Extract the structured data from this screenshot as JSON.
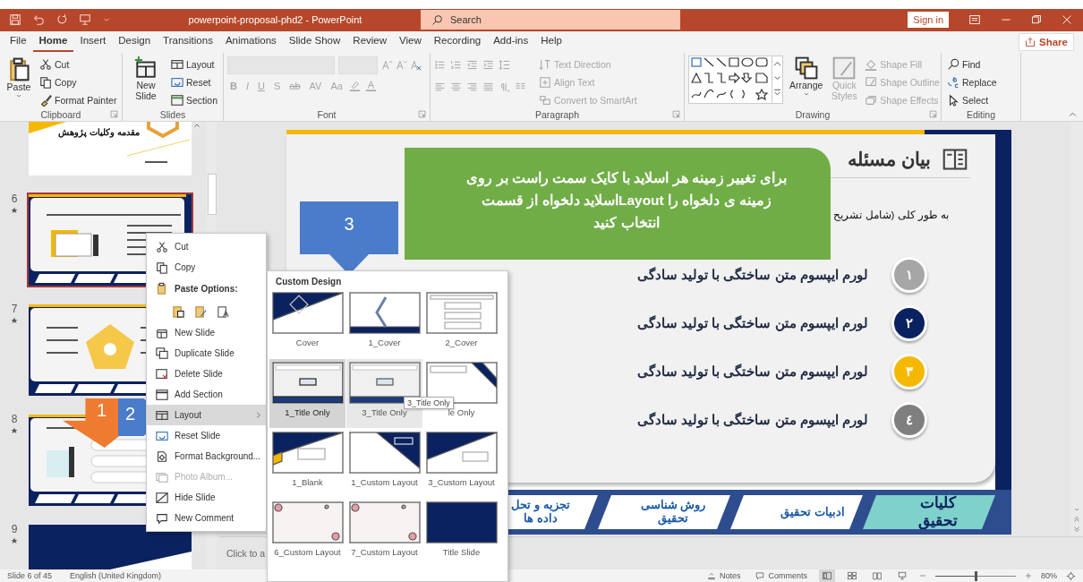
{
  "window": {
    "title": "powerpoint-proposal-phd2  -  PowerPoint",
    "search_placeholder": "Search",
    "sign_in": "Sign in"
  },
  "menu_tabs": [
    {
      "label": "File",
      "selected": false
    },
    {
      "label": "Home",
      "selected": true
    },
    {
      "label": "Insert",
      "selected": false
    },
    {
      "label": "Design",
      "selected": false
    },
    {
      "label": "Transitions",
      "selected": false
    },
    {
      "label": "Animations",
      "selected": false
    },
    {
      "label": "Slide Show",
      "selected": false
    },
    {
      "label": "Review",
      "selected": false
    },
    {
      "label": "View",
      "selected": false
    },
    {
      "label": "Recording",
      "selected": false
    },
    {
      "label": "Add-ins",
      "selected": false
    },
    {
      "label": "Help",
      "selected": false
    }
  ],
  "share": "Share",
  "ribbon": {
    "clipboard": {
      "label": "Clipboard",
      "paste": "Paste",
      "cut": "Cut",
      "copy": "Copy",
      "format_painter": "Format Painter"
    },
    "slides": {
      "label": "Slides",
      "new_slide": "New Slide",
      "layout": "Layout",
      "reset": "Reset",
      "section": "Section"
    },
    "font": {
      "label": "Font",
      "disabled": true,
      "buttons": [
        "B",
        "I",
        "U",
        "S",
        "ab",
        "AV",
        "Aa"
      ]
    },
    "paragraph": {
      "label": "Paragraph",
      "disabled": true,
      "text_direction": "Text Direction",
      "align_text": "Align Text",
      "convert": "Convert to SmartArt"
    },
    "drawing": {
      "label": "Drawing",
      "arrange": "Arrange",
      "quick_styles": "Quick Styles",
      "quick_styles_disabled": true,
      "shape_fill": "Shape Fill",
      "shape_outline": "Shape Outline",
      "shape_effects": "Shape Effects",
      "shape_format_disabled": true
    },
    "editing": {
      "label": "Editing",
      "find": "Find",
      "replace": "Replace",
      "select": "Select"
    }
  },
  "thumbnails": [
    {
      "kind": "intro",
      "title": "مقدمه وکلیات پژوهش",
      "selected": false
    },
    {
      "kind": "problem",
      "number": "6",
      "selected": true
    },
    {
      "kind": "pentagon",
      "number": "7",
      "selected": false
    },
    {
      "kind": "list",
      "number": "8",
      "selected": false
    },
    {
      "kind": "section",
      "number": "9",
      "selected": false
    }
  ],
  "slide": {
    "heading": "بیان مسئله",
    "intro": "به طور کلی (شامل تشریح",
    "points": [
      {
        "number": "١",
        "text": "لورم ایپسوم متن ساختگی با تولید سادگی",
        "color": "#a6a6a6"
      },
      {
        "number": "٢",
        "text": "لورم ایپسوم متن ساختگی با تولید سادگی",
        "color": "#0b2260"
      },
      {
        "number": "٣",
        "text": "لورم ایپسوم متن ساختگی با تولید سادگی",
        "color": "#f5b800"
      },
      {
        "number": "٤",
        "text": "لورم ایپسوم متن ساختگی با تولید سادگی",
        "color": "#7f7f7f"
      }
    ],
    "footer_tabs": [
      {
        "label": "کلیات تحقیق",
        "selected": true
      },
      {
        "label": "ادبیات تحقیق",
        "selected": false
      },
      {
        "label": "روش شناسی تحقیق",
        "selected": false
      },
      {
        "label": "تجزیه و تحل داده ها",
        "selected": false
      }
    ]
  },
  "callout": {
    "text": "برای تغییر زمینه هر اسلاید با کایک سمت راست بر روی\nزمینه ی دلخواه را  Layoutاسلاید دلخواه از قسمت\nانتخاب کنید"
  },
  "step_arrows": [
    {
      "label": "1",
      "kind": "down-orange"
    },
    {
      "label": "2",
      "kind": "right-blue"
    },
    {
      "label": "3",
      "kind": "down-blue"
    }
  ],
  "context_menu": [
    {
      "kind": "command",
      "label": "Cut",
      "disabled": false,
      "highlighted": false
    },
    {
      "kind": "command",
      "label": "Copy",
      "disabled": false,
      "highlighted": false
    },
    {
      "kind": "header",
      "label": "Paste Options:",
      "disabled": false,
      "highlighted": false
    },
    {
      "kind": "paste",
      "disabled": false,
      "highlighted": false
    },
    {
      "kind": "command",
      "label": "New Slide",
      "disabled": false,
      "highlighted": false
    },
    {
      "kind": "command",
      "label": "Duplicate Slide",
      "disabled": false,
      "highlighted": false
    },
    {
      "kind": "command",
      "label": "Delete Slide",
      "disabled": false,
      "highlighted": false
    },
    {
      "kind": "command",
      "label": "Add Section",
      "disabled": false,
      "highlighted": false
    },
    {
      "kind": "submenu",
      "label": "Layout",
      "disabled": false,
      "highlighted": true
    },
    {
      "kind": "command",
      "label": "Reset Slide",
      "disabled": false,
      "highlighted": false
    },
    {
      "kind": "command",
      "label": "Format Background...",
      "disabled": false,
      "highlighted": false
    },
    {
      "kind": "command",
      "label": "Photo Album...",
      "disabled": true,
      "highlighted": false
    },
    {
      "kind": "command",
      "label": "Hide Slide",
      "disabled": false,
      "highlighted": false
    },
    {
      "kind": "command",
      "label": "New Comment",
      "disabled": false,
      "highlighted": false
    }
  ],
  "layout_gallery": {
    "title": "Custom Design",
    "tooltip": "3_Title Only",
    "items": [
      {
        "kind": "diagonal",
        "label": "Cover",
        "selected": false,
        "hovered": false
      },
      {
        "kind": "chevron",
        "label": "1_Cover",
        "selected": false,
        "hovered": false
      },
      {
        "kind": "boxes",
        "label": "2_Cover",
        "selected": false,
        "hovered": false
      },
      {
        "kind": "title-only",
        "label": "1_Title Only",
        "selected": true,
        "hovered": false
      },
      {
        "kind": "title-only",
        "label": "3_Title Only",
        "selected": false,
        "hovered": true
      },
      {
        "kind": "corner",
        "label": "le Only",
        "selected": false,
        "hovered": false
      },
      {
        "kind": "diagonal-yellow",
        "label": "1_Blank",
        "selected": false,
        "hovered": false
      },
      {
        "kind": "corner-box",
        "label": "1_Custom Layout",
        "selected": false,
        "hovered": false
      },
      {
        "kind": "diagonal-box",
        "label": "3_Custom Layout",
        "selected": false,
        "hovered": false
      },
      {
        "kind": "floral",
        "label": "6_Custom Layout",
        "selected": false,
        "hovered": false
      },
      {
        "kind": "floral",
        "label": "7_Custom Layout",
        "selected": false,
        "hovered": false
      },
      {
        "kind": "solid",
        "label": "Title Slide",
        "selected": false,
        "hovered": false
      }
    ]
  },
  "notes": {
    "placeholder": "Click to a"
  },
  "status_bar": {
    "slide": "Slide 6 of 45",
    "language": "English (United Kingdom)",
    "notes": "Notes",
    "comments": "Comments",
    "views": [
      {
        "selected": true
      },
      {
        "selected": false
      },
      {
        "selected": false
      },
      {
        "selected": false
      }
    ],
    "zoom_slider": {
      "level": 0.5
    },
    "zoom": "80%"
  }
}
